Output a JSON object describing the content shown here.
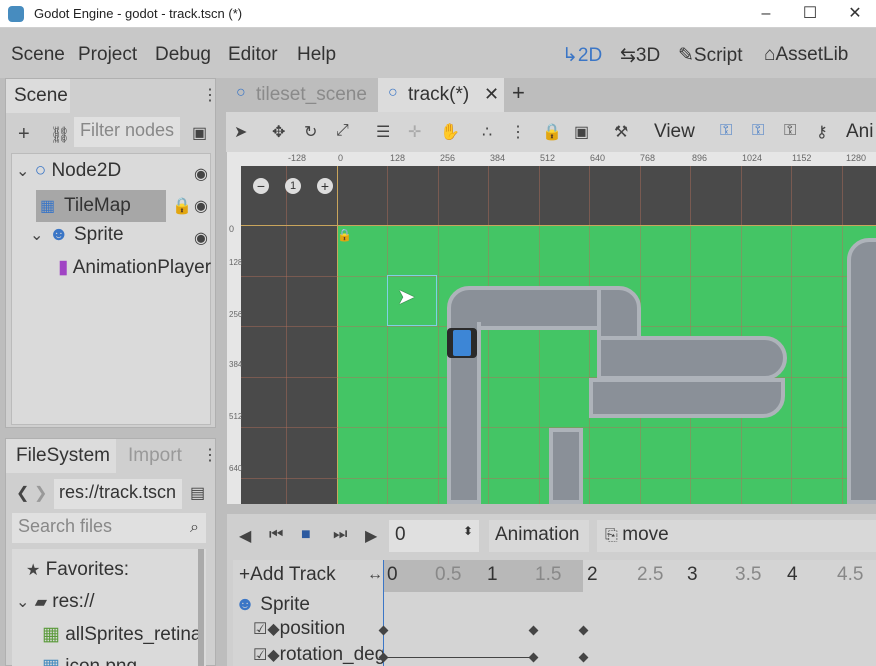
{
  "window": {
    "title": "Godot Engine - godot - track.tscn (*)"
  },
  "menu": {
    "scene": "Scene",
    "project": "Project",
    "debug": "Debug",
    "editor": "Editor",
    "help": "Help"
  },
  "modes": {
    "m2d": "2D",
    "m3d": "3D",
    "script": "Script",
    "assetlib": "AssetLib"
  },
  "scene_dock": {
    "tab": "Scene",
    "filter_placeholder": "Filter nodes",
    "nodes": [
      "Node2D",
      "TileMap",
      "Sprite",
      "AnimationPlayer"
    ]
  },
  "editor_tabs": {
    "tab1": "tileset_scene",
    "tab2": "track(*)"
  },
  "toolbar": {
    "view": "View",
    "anim": "Ani"
  },
  "ruler": {
    "x_ticks": [
      "-128",
      "0",
      "128",
      "256",
      "384",
      "512",
      "640",
      "768",
      "896",
      "1024",
      "1152",
      "1280"
    ],
    "y_ticks": [
      "0",
      "128",
      "256",
      "384",
      "512",
      "640"
    ]
  },
  "filesystem": {
    "tab": "FileSystem",
    "import_tab": "Import",
    "path": "res://track.tscn",
    "search_placeholder": "Search files",
    "items": [
      "Favorites:",
      "res://",
      "allSprites_retina",
      "icon.png"
    ]
  },
  "animation": {
    "time": "0",
    "anim_label": "Animation",
    "anim_name": "move",
    "add_track": "Add Track",
    "timeline": [
      "0",
      "0.5",
      "1",
      "1.5",
      "2",
      "2.5",
      "3",
      "3.5",
      "4",
      "4.5"
    ],
    "track_owner": "Sprite",
    "tracks": [
      "position",
      "rotation_degrees"
    ]
  },
  "colors": {
    "accent": "#3b76c6",
    "grass": "#44c565",
    "road": "#8a9098"
  }
}
